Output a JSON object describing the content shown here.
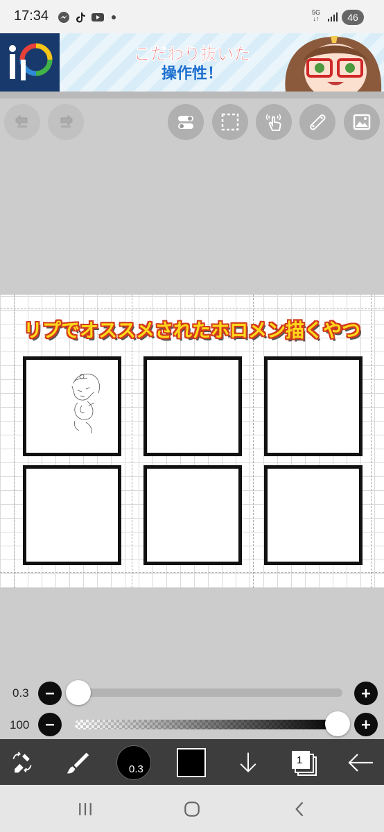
{
  "status_bar": {
    "time": "17:34",
    "icons": [
      "messenger-icon",
      "tiktok-icon",
      "youtube-icon",
      "dot-icon"
    ],
    "network": "5G",
    "battery": "46"
  },
  "ad": {
    "line1": "こだわり抜いた",
    "line2": "操作性！",
    "logo_text": "iP"
  },
  "top_toolbar": {
    "buttons": [
      "undo-icon",
      "redo-icon",
      "toggle-icon",
      "selection-icon",
      "gesture-icon",
      "ruler-icon",
      "image-icon"
    ]
  },
  "canvas": {
    "title": "リプでオススメされたホロメン描くやつ",
    "panel_count": 6
  },
  "sliders": {
    "size_label": "0.3",
    "size_value": 0.0,
    "opacity_label": "100",
    "opacity_value": 1.0
  },
  "bottom_toolbar": {
    "brush_size": "0.3",
    "color": "#000000",
    "layer_count": "1"
  },
  "colors": {
    "toolbar_bg": "#3d3d3d",
    "workspace_bg": "#cccccc",
    "title_fill": "#ffd91a",
    "title_outline": "#d23a1c"
  }
}
